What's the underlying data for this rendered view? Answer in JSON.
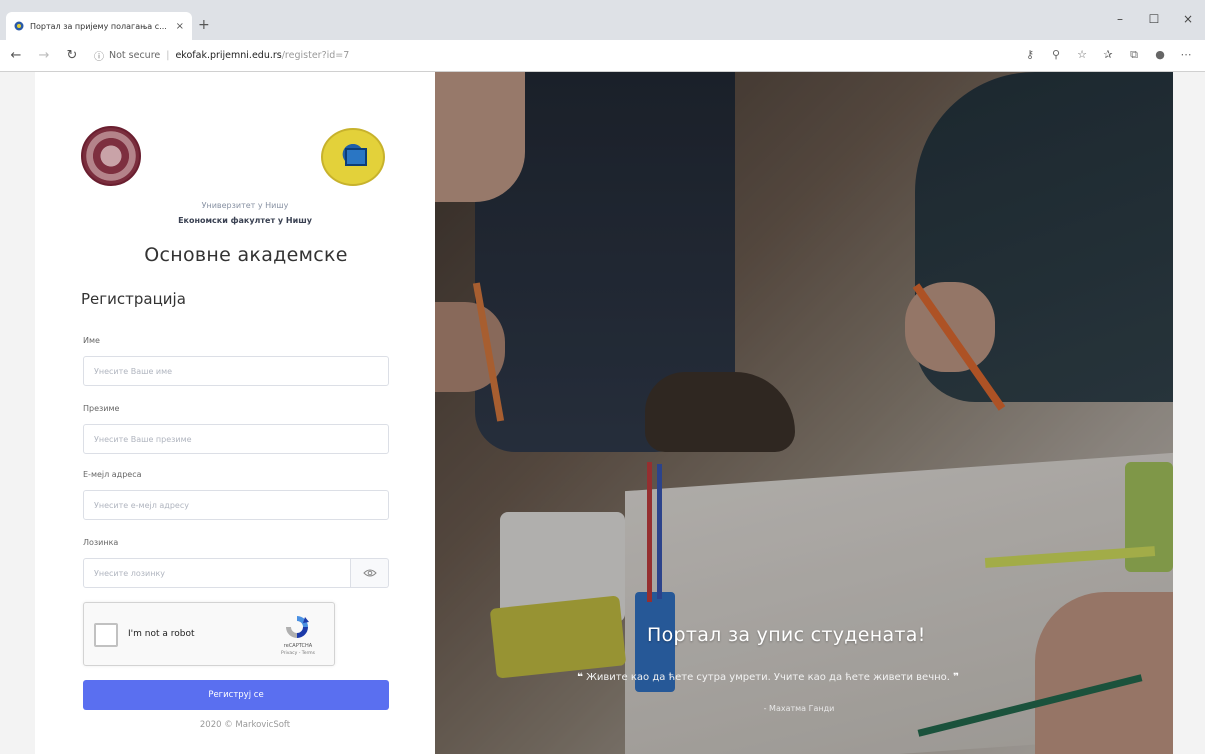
{
  "browser": {
    "tab_title": "Портал за пријему полагања с...",
    "tab_close": "×",
    "new_tab": "+",
    "url_not_secure": "Not secure",
    "url_separator": "|",
    "url_host": "ekofak.prijemni.edu.rs",
    "url_path": "/register?id=7",
    "window": {
      "minimize": "–",
      "maximize": "☐",
      "close": "×"
    }
  },
  "header": {
    "university": "Универзитет у Нишу",
    "faculty": "Економски факултет у Нишу",
    "title": "Основне академске"
  },
  "form": {
    "section_title": "Регистрација",
    "fields": [
      {
        "label": "Име",
        "placeholder": "Унесите Ваше име",
        "value": ""
      },
      {
        "label": "Презиме",
        "placeholder": "Унесите Ваше презиме",
        "value": ""
      },
      {
        "label": "Е-мејл адреса",
        "placeholder": "Унесите е-мејл адресу",
        "value": ""
      },
      {
        "label": "Лозинка",
        "placeholder": "Унесите лозинку",
        "value": ""
      }
    ],
    "recaptcha": {
      "label": "I'm not a robot",
      "brand": "reCAPTCHA",
      "terms": "Privacy - Terms"
    },
    "submit_label": "Региструј се",
    "footer": "2020 © MarkovicSoft"
  },
  "hero": {
    "title": "Портал за упис студената!",
    "quote_open": "❝",
    "quote": "Живите као да ћете сутра умрети. Учите као да ћете живети вечно.",
    "quote_close": "❞",
    "author": "- Махатма Ганди"
  },
  "colors": {
    "accent": "#5a6ff0",
    "recaptcha_blue": "#1c3aa9",
    "recaptcha_light": "#4a90e2"
  }
}
